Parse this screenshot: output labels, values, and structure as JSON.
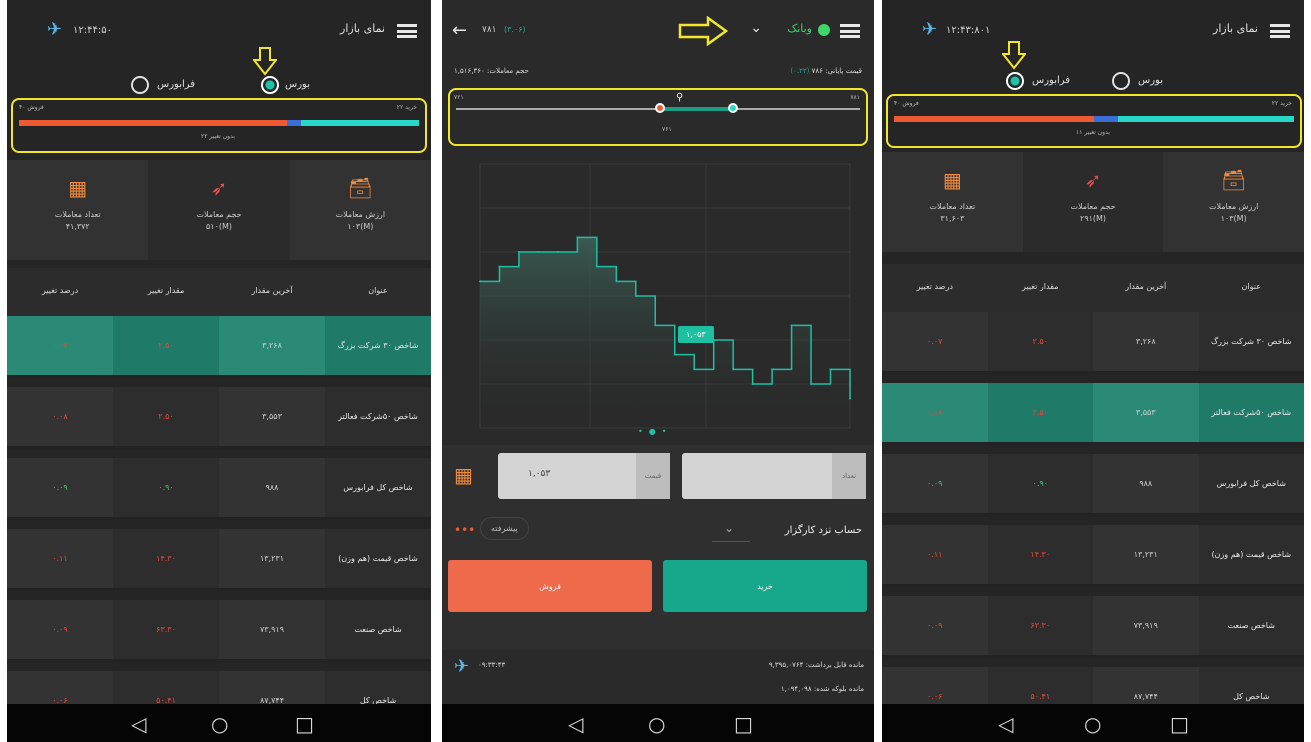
{
  "market": {
    "title": "نمای بازار",
    "bourse": "بورس",
    "farabourse": "فرابورس",
    "time_left": "۱۲:۴۴:۵۰",
    "time_right": "۱۲:۴۳:۸۰۱",
    "bar_left_label": "فروش ۴۰",
    "bar_right_label": "خرید ۲۲",
    "bar_center_label": "بدون تغییر ۲۲",
    "bar_right_panel_left": "فروش ۴۰",
    "bar_right_panel_right": "خرید ۲۲",
    "bar_right_panel_center": "بدون تغییر ۱۱",
    "stats": [
      {
        "label": "ارزش معاملات",
        "value": "۱۰۳(M)"
      },
      {
        "label": "حجم معاملات",
        "value": "۵۱۰(M)"
      },
      {
        "label": "تعداد معاملات",
        "value": "۴۱,۳۷۲"
      }
    ],
    "stats_right": [
      {
        "label": "ارزش معاملات",
        "value": "۱۰۳(M)"
      },
      {
        "label": "حجم معاملات",
        "value": "۲۹۱(M)"
      },
      {
        "label": "تعداد معاملات",
        "value": "۳۱,۶۰۳"
      }
    ],
    "headers": [
      "عنوان",
      "آخرین مقدار",
      "مقدار تغییر",
      "درصد تغییر"
    ],
    "rows": [
      {
        "name": "شاخص ۳۰ شرکت بزرگ",
        "last": "۳,۲۶۸",
        "change": "۲.۵۰",
        "pct": "۰.۰۷"
      },
      {
        "name": "شاخص ۵۰شرکت فعالتر",
        "last": "۳,۵۵۳",
        "change": "۲.۵۰",
        "pct": "۰.۰۸"
      },
      {
        "name": "شاخص کل فرابورس",
        "last": "۹۸۸",
        "change": "۰.۹۰",
        "pct": "۰.۰۹"
      },
      {
        "name": "شاخص قیمت (هم وزن)",
        "last": "۱۳,۲۳۱",
        "change": "۱۴.۳۰",
        "pct": "۰.۱۱"
      },
      {
        "name": "شاخص صنعت",
        "last": "۷۳,۹۱۹",
        "change": "۶۳.۳۰",
        "pct": "۰.۰۹"
      },
      {
        "name": "شاخص کل",
        "last": "۸۷,۷۴۴",
        "change": "۵۰.۴۱",
        "pct": "۰.۰۶"
      }
    ],
    "rows_right": [
      {
        "name": "شاخص ۳۰ شرکت بزرگ",
        "last": "۳,۲۶۸",
        "change": "۲.۵۰",
        "pct": "۰.۰۷"
      },
      {
        "name": "شاخص ۵۰شرکت فعالتر",
        "last": "۳,۵۵۳",
        "change": "۲.۵۰",
        "pct": "۰.۰۸"
      },
      {
        "name": "شاخص کل فرابورس",
        "last": "۹۸۸",
        "change": "۰.۹۰",
        "pct": "۰.۰۹"
      },
      {
        "name": "شاخص قیمت (هم وزن)",
        "last": "۱۳,۲۳۱",
        "change": "۱۴.۳۰",
        "pct": "۰.۱۱"
      },
      {
        "name": "شاخص صنعت",
        "last": "۷۳,۹۱۹",
        "change": "۶۳.۳۰",
        "pct": "۰.۰۹"
      },
      {
        "name": "شاخص کل",
        "last": "۸۷,۷۴۴",
        "change": "۵۰.۴۱",
        "pct": "۰.۰۶"
      }
    ]
  },
  "trade": {
    "symbol": "وبانک",
    "header_price": "۷۸۱",
    "header_change": "(۳.۰۶)",
    "final_price_label": "قیمت پایانی",
    "final_price_value": "۷۸۶",
    "final_price_change": "(۰.۲۲)",
    "volume_label": "حجم معاملات",
    "volume_value": "۱,۵۱۶,۳۶۰",
    "range_low": "۷۲۱",
    "range_high": "۷۸۱",
    "range_mid": "۷۶۱",
    "price_tag": "۱,۰۵۳",
    "price_label": "قیمت",
    "price_value": "۱,۰۵۳",
    "qty_label": "تعداد",
    "account_label": "حساب نزد کارگزار",
    "advanced_label": "پیشرفته",
    "buy_label": "خرید",
    "sell_label": "فروش",
    "balance_label": "مانده قابل برداشت:",
    "balance_value": "۹,۳۹۵,۰۷۶۴",
    "blocked_label": "مانده بلوکه شده:",
    "blocked_value": "۱,۰۹۴,۰۹۸",
    "time": "۰۹:۳۳:۴۳"
  },
  "chart_data": {
    "type": "line",
    "x": [
      0,
      1,
      2,
      3,
      4,
      5,
      6,
      7,
      8,
      9,
      10,
      11,
      12,
      13,
      14,
      15,
      16,
      17,
      18,
      19
    ],
    "values": [
      1.5,
      1.55,
      1.6,
      1.6,
      1.6,
      1.65,
      1.55,
      1.5,
      1.45,
      1.35,
      1.25,
      1.2,
      1.3,
      1.2,
      1.15,
      1.2,
      1.35,
      1.15,
      1.2,
      1.1
    ],
    "ylim": [
      1.0,
      1.9
    ],
    "grid": true
  },
  "colors": {
    "accent": "#1f9e86",
    "buy": "#17a88c",
    "sell": "#ef6a4a",
    "highlight": "#f2e62a"
  }
}
